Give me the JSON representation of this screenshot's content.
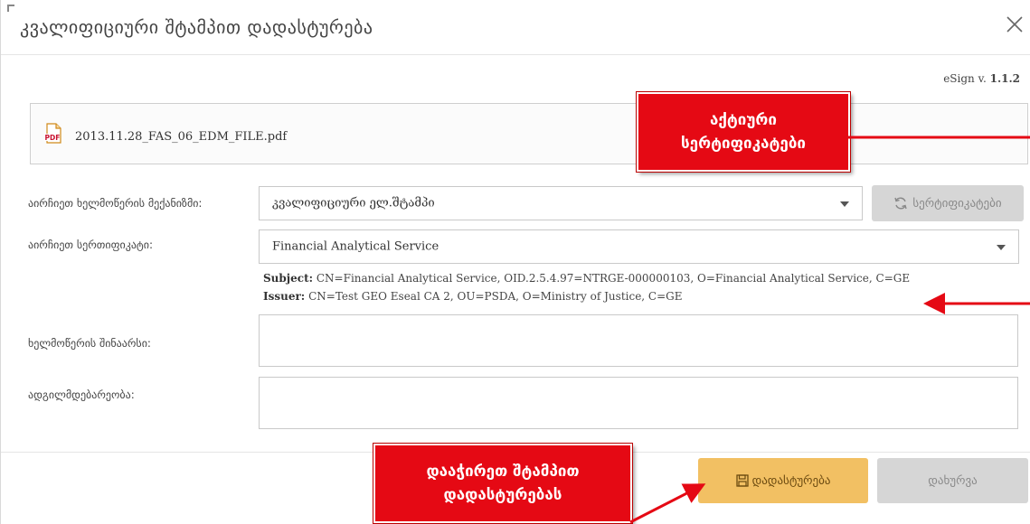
{
  "dialog": {
    "title": "კვალიფიციური შტამპით დადასტურება",
    "version_prefix": "eSign v.",
    "version_number": "1.1.2",
    "file_name": "2013.11.28_FAS_06_EDM_FILE.pdf"
  },
  "form": {
    "mechanism_label": "აირჩიეთ ხელმოწერის მექანიზმი:",
    "mechanism_value": "კვალიფიციური ელ.შტამპი",
    "certificates_button": "სერტიფიკატები",
    "certificate_label": "აირჩიეთ სერთიფიკატი:",
    "certificate_value": "Financial Analytical Service",
    "subject_label": "Subject:",
    "subject_value": "CN=Financial Analytical Service, OID.2.5.4.97=NTRGE-000000103, O=Financial Analytical Service, C=GE",
    "issuer_label": "Issuer:",
    "issuer_value": "CN=Test GEO Eseal CA 2, OU=PSDA, O=Ministry of Justice, C=GE",
    "content_label": "ხელმოწერის შინაარსი:",
    "location_label": "ადგილმდებარეობა:"
  },
  "footer": {
    "confirm_button": "დადასტურება",
    "close_button": "დახურვა"
  },
  "annotations": {
    "callout_active_line1": "აქტიური",
    "callout_active_line2": "სერტიფიკატები",
    "callout_confirm_line1": "დააჭირეთ შტამპით",
    "callout_confirm_line2": "დადასტურებას",
    "callout_color": "#e50914"
  },
  "colors": {
    "confirm_button": "#f2c063",
    "disabled_button": "#d6d6d6"
  },
  "icons": {
    "close": "close-icon",
    "pdf": "pdf-file-icon",
    "refresh": "refresh-icon",
    "save": "save-icon"
  }
}
